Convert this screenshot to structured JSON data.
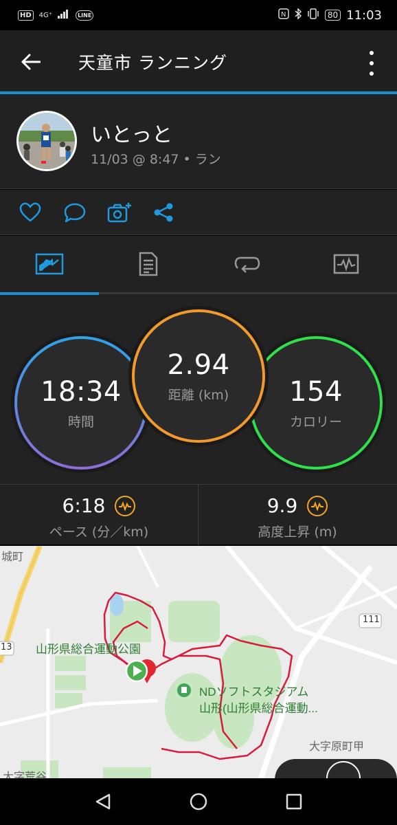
{
  "status_bar": {
    "left": [
      "HD",
      "4G⁺",
      "LINE"
    ],
    "battery": "80",
    "time": "11:03"
  },
  "app_bar": {
    "title": "天童市 ランニング"
  },
  "profile": {
    "name": "いとっと",
    "meta": "11/03 @ 8:47 • ラン"
  },
  "tabs": [
    {
      "icon": "chart-icon",
      "active": true
    },
    {
      "icon": "details-icon",
      "active": false
    },
    {
      "icon": "laps-icon",
      "active": false
    },
    {
      "icon": "graph-icon",
      "active": false
    }
  ],
  "stats": {
    "time": {
      "value": "18:34",
      "label": "時間",
      "color": "#4aa3e8"
    },
    "distance": {
      "value": "2.94",
      "label": "距離 (km)",
      "color": "#f39a2c"
    },
    "calories": {
      "value": "154",
      "label": "カロリー",
      "color": "#2ee14a"
    }
  },
  "metrics": {
    "pace": {
      "value": "6:18",
      "label": "ペース (分／km)"
    },
    "elevation": {
      "value": "9.9",
      "label": "高度上昇 (m)"
    }
  },
  "map": {
    "labels": {
      "town_top": "城町",
      "park": "山形県総合運動公園",
      "stadium_line1": "NDソフトスタジアム",
      "stadium_line2": "山形(山形県総合運動...",
      "district": "大字原町甲",
      "district2": "大字荒谷",
      "road_111": "111",
      "road_13": "13"
    },
    "route_color": "#d81b3c"
  }
}
